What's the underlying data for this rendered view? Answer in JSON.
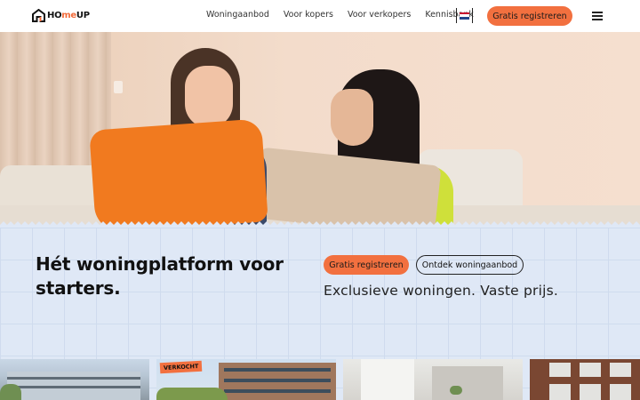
{
  "header": {
    "logo": {
      "part1": "HO",
      "part2": "me",
      "part3": "UP"
    },
    "nav": [
      "Woningaanbod",
      "Voor kopers",
      "Voor verkopers",
      "Kennisbank"
    ],
    "cta_label": "Gratis registreren"
  },
  "hero": {
    "headline": "Hét woningplatform voor starters.",
    "primary_button": "Gratis registreren",
    "secondary_button": "Ontdek woningaanbod",
    "tagline": "Exclusieve woningen. Vaste prijs."
  },
  "listings": [
    {
      "badge": ""
    },
    {
      "badge": "VERKOCHT"
    },
    {
      "badge": ""
    },
    {
      "badge": ""
    }
  ],
  "colors": {
    "accent": "#f2703f",
    "background": "#dfe8f6",
    "text": "#111111"
  },
  "icons": [
    "home-logo-icon",
    "nl-flag-icon",
    "hamburger-menu-icon"
  ]
}
